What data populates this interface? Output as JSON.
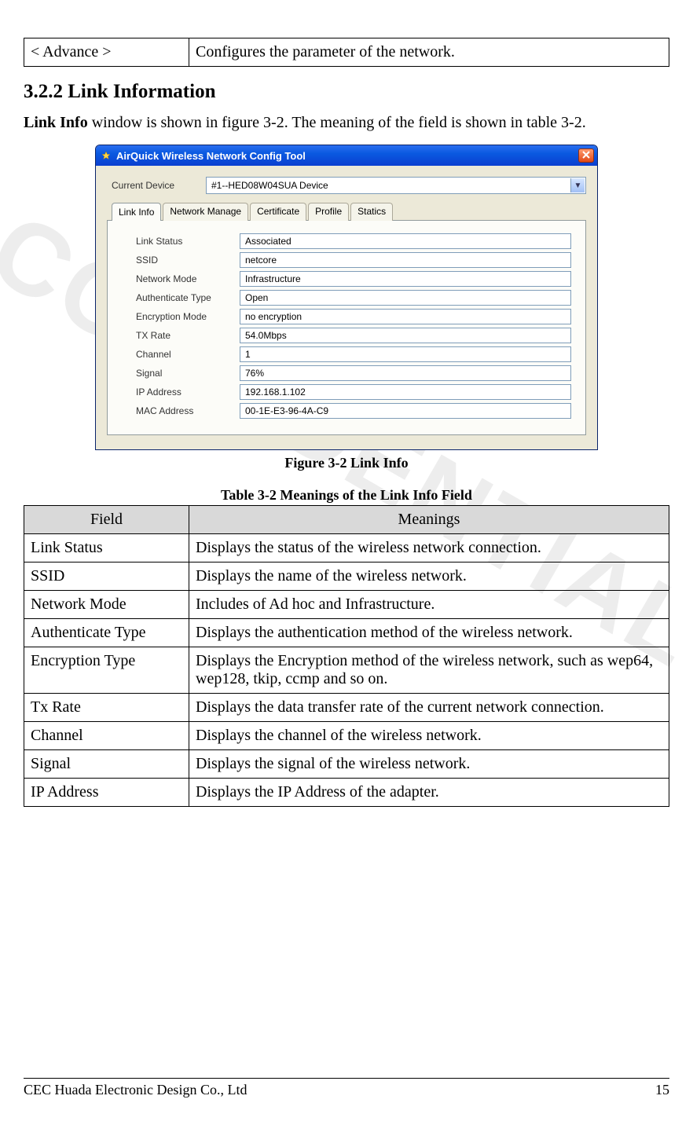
{
  "watermark": "CONFIDENTIAL",
  "param_row": {
    "key": "< Advance >",
    "val": "Configures the parameter of the network."
  },
  "heading": "3.2.2 Link Information",
  "intro": {
    "bold": "Link Info",
    "rest": " window is shown in figure 3-2. The meaning of the field is shown in table 3-2."
  },
  "win": {
    "title": "AirQuick Wireless Network Config Tool",
    "cur_dev_label": "Current Device",
    "cur_dev_value": "#1--HED08W04SUA Device",
    "tabs": [
      "Link Info",
      "Network Manage",
      "Certificate",
      "Profile",
      "Statics"
    ],
    "fields": [
      {
        "label": "Link Status",
        "value": "Associated"
      },
      {
        "label": "SSID",
        "value": "netcore"
      },
      {
        "label": "Network Mode",
        "value": "Infrastructure"
      },
      {
        "label": "Authenticate Type",
        "value": "Open"
      },
      {
        "label": "Encryption Mode",
        "value": "no encryption"
      },
      {
        "label": "TX Rate",
        "value": "54.0Mbps"
      },
      {
        "label": "Channel",
        "value": "1"
      },
      {
        "label": "Signal",
        "value": "76%"
      },
      {
        "label": "IP Address",
        "value": "192.168.1.102"
      },
      {
        "label": "MAC Address",
        "value": "00-1E-E3-96-4A-C9"
      }
    ]
  },
  "fig_caption": "Figure 3-2 Link Info",
  "tbl_caption": "Table 3-2 Meanings of the Link Info Field",
  "meanings": {
    "headers": [
      "Field",
      "Meanings"
    ],
    "rows": [
      {
        "field": "Link Status",
        "meaning": "Displays the status of the wireless network connection."
      },
      {
        "field": "SSID",
        "meaning": "Displays the name of the wireless network."
      },
      {
        "field": "Network Mode",
        "meaning": "Includes of Ad hoc and Infrastructure."
      },
      {
        "field": "Authenticate Type",
        "meaning": "Displays the authentication method of the wireless network."
      },
      {
        "field": "Encryption Type",
        "meaning": "Displays the Encryption method of the wireless network, such as wep64, wep128, tkip, ccmp and so on."
      },
      {
        "field": "Tx Rate",
        "meaning": "Displays the data transfer rate of the current network connection."
      },
      {
        "field": "Channel",
        "meaning": "Displays the channel of the wireless network."
      },
      {
        "field": "Signal",
        "meaning": "Displays the signal of the wireless network."
      },
      {
        "field": "IP Address",
        "meaning": "Displays the IP Address of the adapter."
      }
    ]
  },
  "footer": {
    "left": "CEC Huada Electronic Design Co., Ltd",
    "right": "15"
  }
}
